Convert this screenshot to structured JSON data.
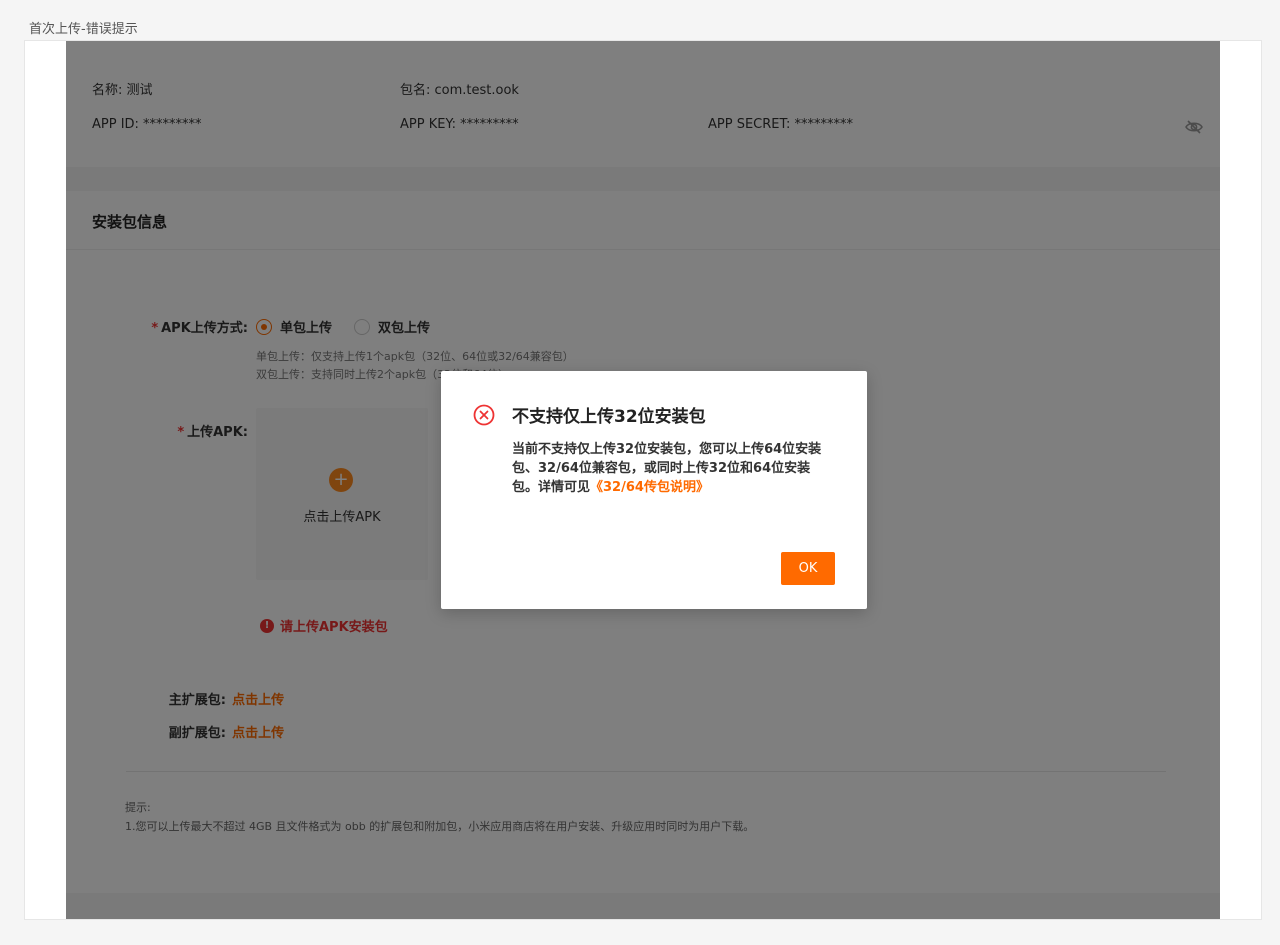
{
  "page_label": "首次上传-错误提示",
  "app_info": {
    "name": "名称: 测试",
    "package": "包名: com.test.ook",
    "app_id": "APP ID: *********",
    "app_key": "APP KEY: *********",
    "app_secret": "APP SECRET: *********",
    "visibility_icon": "eye-slash-icon"
  },
  "section": {
    "title": "安装包信息",
    "upload_mode": {
      "required_mark": "*",
      "label": "APK上传方式:",
      "options": [
        {
          "label": "单包上传",
          "selected": true
        },
        {
          "label": "双包上传",
          "selected": false
        }
      ],
      "hint_single": "单包上传：仅支持上传1个apk包（32位、64位或32/64兼容包）",
      "hint_double": "双包上传：支持同时上传2个apk包（32位和64位）"
    },
    "upload_apk": {
      "required_mark": "*",
      "label": "上传APK:",
      "box_text": "点击上传APK",
      "error_icon": "!",
      "error_text": "请上传APK安装包"
    },
    "main_ext": {
      "label": "主扩展包:",
      "link": "点击上传"
    },
    "sub_ext": {
      "label": "副扩展包:",
      "link": "点击上传"
    },
    "tips_title": "提示:",
    "tips_line1": "1.您可以上传最大不超过 4GB 且文件格式为 obb 的扩展包和附加包，小米应用商店将在用户安装、升级应用时同时为用户下载。"
  },
  "dialog": {
    "icon": "error-circle-icon",
    "title": "不支持仅上传32位安装包",
    "body": "当前不支持仅上传32位安装包，您可以上传64位安装包、32/64位兼容包，或同时上传32位和64位安装包。详情可见",
    "link": "《32/64传包说明》",
    "ok_label": "OK"
  },
  "colors": {
    "accent": "#ff6a00",
    "error": "#e33333",
    "overlay": "rgba(0,0,0,0.5)"
  }
}
